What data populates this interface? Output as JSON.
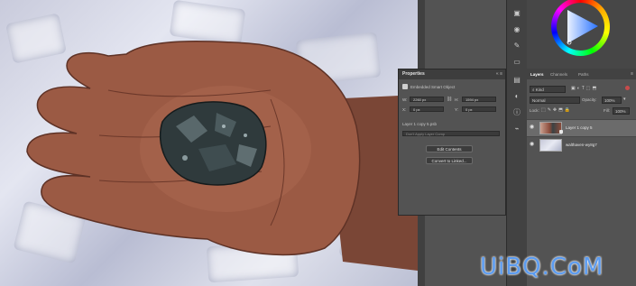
{
  "canvas": {
    "subject": "hand holding dark crystalline rock on crushed ice"
  },
  "right_strip": {
    "icons": [
      "cube-icon",
      "sphere-icon",
      "brush-settings-icon",
      "frame-icon",
      "history-icon",
      "adjustments-icon",
      "info-icon",
      "paths-icon"
    ]
  },
  "color": {
    "wheel": "color-wheel-icon"
  },
  "properties": {
    "title": "Properties",
    "object_type": "Embedded Smart Object",
    "w_label": "W:",
    "w_value": "2260 px",
    "h_label": "H:",
    "h_value": "1594 px",
    "x_label": "X:",
    "x_value": "0 px",
    "y_label": "Y:",
    "y_value": "0 px",
    "source": "Layer 1 copy 5.psb",
    "layer_comp_placeholder": "Don't Apply Layer Comp",
    "edit_contents": "Edit Contents",
    "convert_to_linked": "Convert to Linked..."
  },
  "layers": {
    "tabs": [
      "Layers",
      "Channels",
      "Paths"
    ],
    "active_tab": "Layers",
    "filter_kind": "Kind",
    "blend_mode": "Normal",
    "opacity_label": "Opacity:",
    "opacity_value": "100%",
    "lock_label": "Lock:",
    "fill_label": "Fill:",
    "fill_value": "100%",
    "items": [
      {
        "name": "Layer 1 copy 5",
        "selected": true,
        "smart": true
      },
      {
        "name": "walthaven-wy8g7",
        "selected": false,
        "smart": false
      }
    ]
  },
  "watermark": {
    "text": "UiBQ.CoM"
  }
}
